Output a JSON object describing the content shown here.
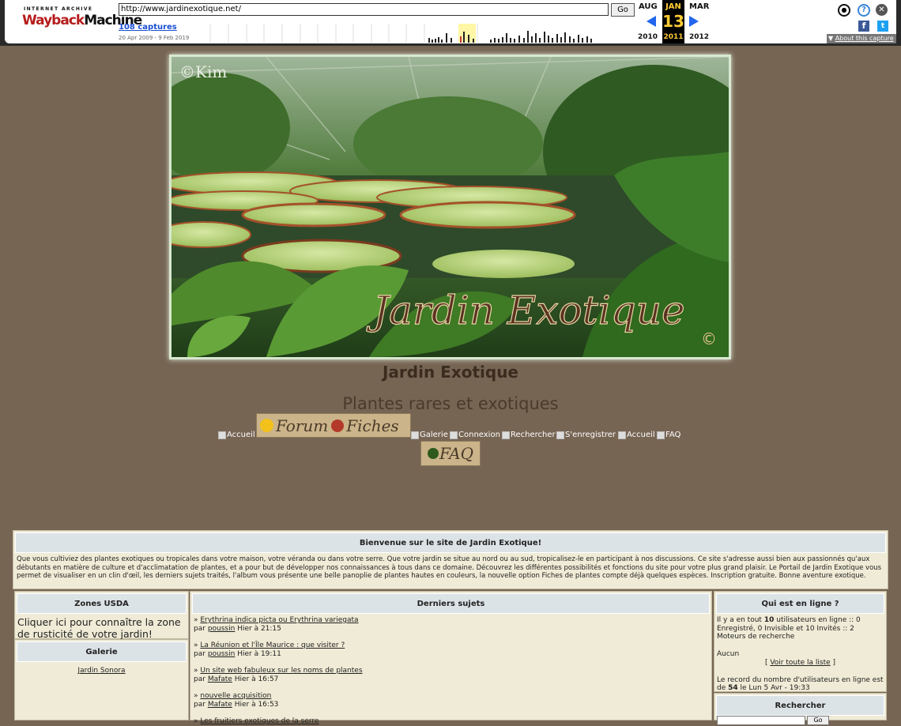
{
  "wayback": {
    "logo_top": "INTERNET ARCHIVE",
    "logo_wayback": "Wayback",
    "logo_machine": "Machine",
    "url": "http://www.jardinexotique.net/",
    "go_label": "Go",
    "captures": "108 captures",
    "date_range": "20 Apr 2009 - 9 Feb 2019",
    "prev_month": "AUG",
    "cur_month": "JAN",
    "next_month": "MAR",
    "cur_day": "13",
    "prev_year": "2010",
    "cur_year": "2011",
    "next_year": "2012",
    "about": "About this capture",
    "colors": {
      "highlight": "#ffcc33",
      "link": "#1a4fd6",
      "arrow": "#2266ee"
    }
  },
  "banner": {
    "copyright_top": "©Kim",
    "title_art": "Jardin Exotique",
    "copyright_mark": "©"
  },
  "site": {
    "title": "Jardin Exotique",
    "description": "Plantes rares et exotiques"
  },
  "nav": {
    "accueil": "Accueil",
    "forum_img": "Forum",
    "fiches_img": "Fiches",
    "galerie": "Galerie",
    "connexion": "Connexion",
    "rechercher": "Rechercher",
    "enregistrer": "S'enregistrer",
    "accueil2": "Accueil",
    "faq": "FAQ",
    "faq_img": "FAQ"
  },
  "welcome": {
    "title": "Bienvenue sur le site de Jardin Exotique!",
    "text": "Que vous cultiviez des plantes exotiques ou tropicales dans votre maison, votre véranda ou dans votre serre. Que votre jardin se situe au nord ou au sud, tropicalisez-le en participant à nos discussions. Ce site s'adresse aussi bien aux passionnés qu'aux débutants en matière de culture et d'acclimatation de plantes, et a pour but de développer nos connaissances à tous dans ce domaine. Découvrez les différentes possibilités et fonctions du site pour votre plus grand plaisir. Le Portail de Jardin Exotique vous permet de visualiser en un clin d'œil, les derniers sujets traités, l'album vous présente une belle panoplie de plantes hautes en couleurs, la nouvelle option Fiches de plantes compte déjà quelques espèces. Inscription gratuite. Bonne aventure exotique."
  },
  "left": {
    "usda_title": "Zones USDA",
    "usda_text": "Cliquer ici pour connaître la zone de rusticité de votre jardin!",
    "galerie_title": "Galerie",
    "galerie_link": "Jardin Sonora"
  },
  "center": {
    "title": "Derniers sujets",
    "by": "par",
    "topics": [
      {
        "title": "Erythrina indica picta ou Erythrina variegata",
        "author": "poussin",
        "time": "Hier à 21:15"
      },
      {
        "title": "La Réunion et l'Île Maurice : que visiter ?",
        "author": "poussin",
        "time": "Hier à 19:11"
      },
      {
        "title": "Un site web fabuleux sur les noms de plantes",
        "author": "Mafate",
        "time": "Hier à 16:57"
      },
      {
        "title": "nouvelle acquisition",
        "author": "Mafate",
        "time": "Hier à 16:53"
      },
      {
        "title": "Les fruitiers exotiques de la serre",
        "author": "",
        "time": ""
      }
    ]
  },
  "right": {
    "online_title": "Qui est en ligne ?",
    "online_pre": "Il y a en tout",
    "online_count": "10",
    "online_post": "utilisateurs en ligne :: 0 Enregistré, 0 Invisible et 10 Invités :: 2 Moteurs de recherche",
    "none": "Aucun",
    "see_list": "Voir toute la liste",
    "record_pre": "Le record du nombre d'utilisateurs en ligne est de",
    "record_count": "54",
    "record_post": "le Lun 5 Avr - 19:33",
    "search_title": "Rechercher",
    "search_go": "Go"
  }
}
